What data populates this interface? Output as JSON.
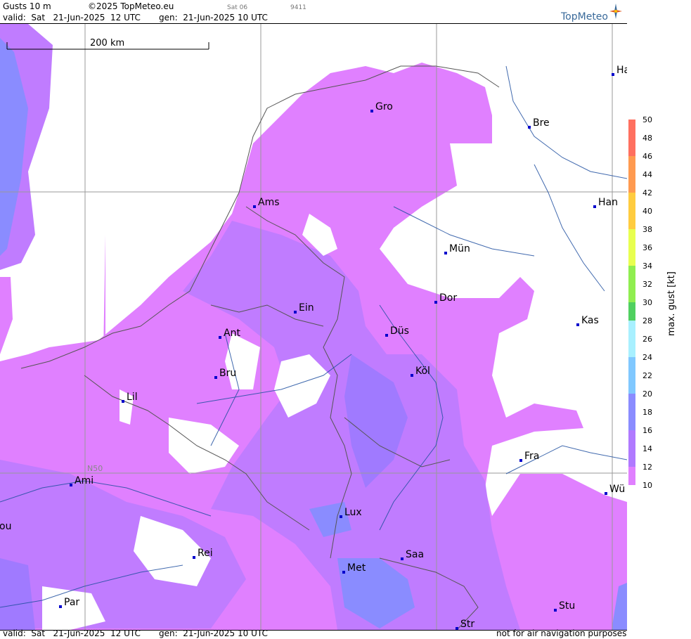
{
  "header": {
    "title": "Gusts 10 m",
    "copyright": "©2025 TopMeteo.eu",
    "model": "Sat 06",
    "code": "9411",
    "valid": "valid:  Sat   21-Jun-2025  12 UTC",
    "gen": "gen:  21-Jun-2025 10 UTC"
  },
  "logo": {
    "name": "TopMeteo"
  },
  "scale_bar": {
    "label": "200 km"
  },
  "gridline_label": "N50",
  "cities": [
    {
      "name": "Gro"
    },
    {
      "name": "Bre"
    },
    {
      "name": "Ha"
    },
    {
      "name": "Ams"
    },
    {
      "name": "Han"
    },
    {
      "name": "Mün"
    },
    {
      "name": "Ein"
    },
    {
      "name": "Dor"
    },
    {
      "name": "Kas"
    },
    {
      "name": "Ant"
    },
    {
      "name": "Düs"
    },
    {
      "name": "Bru"
    },
    {
      "name": "Köl"
    },
    {
      "name": "Lil"
    },
    {
      "name": "Fra"
    },
    {
      "name": "Ami"
    },
    {
      "name": "Wü"
    },
    {
      "name": "ou"
    },
    {
      "name": "Lux"
    },
    {
      "name": "Rei"
    },
    {
      "name": "Saa"
    },
    {
      "name": "Met"
    },
    {
      "name": "Par"
    },
    {
      "name": "Stu"
    },
    {
      "name": "Str"
    }
  ],
  "legend": {
    "label": "max. gust [kt]",
    "ticks": [
      "50",
      "48",
      "46",
      "44",
      "42",
      "40",
      "38",
      "36",
      "34",
      "32",
      "30",
      "28",
      "26",
      "24",
      "22",
      "20",
      "18",
      "16",
      "14",
      "12",
      "10"
    ],
    "colors": {
      "c50": "#ff7060",
      "c46": "#ff9a50",
      "c42": "#ffcc40",
      "c38": "#e8ff50",
      "c34": "#90ee50",
      "c30": "#50d060",
      "c28": "#a8f0ff",
      "c24": "#80c8ff",
      "c20": "#8a8cff",
      "c16": "#b07aff",
      "c12": "#e080ff"
    }
  },
  "footer": {
    "valid": "valid:  Sat   21-Jun-2025  12 UTC",
    "gen": "gen:  21-Jun-2025 10 UTC",
    "notice": "not for air navigation purposes"
  }
}
